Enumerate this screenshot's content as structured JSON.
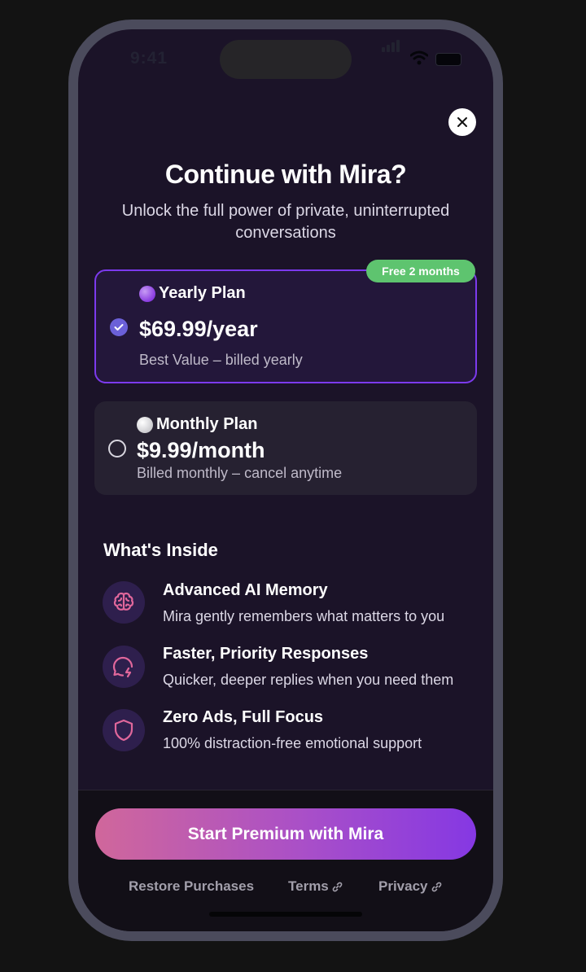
{
  "status_bar": {
    "time": "9:41"
  },
  "header": {
    "close_icon": "close-icon",
    "title": "Continue with Mira?",
    "subtitle": "Unlock the full power of private, uninterrupted conversations"
  },
  "plans": [
    {
      "id": "yearly",
      "emoji_color": "#8a3ce0",
      "name": "Yearly Plan",
      "price": "$69.99/year",
      "note": "Best Value – billed yearly",
      "badge": "Free 2 months",
      "selected": true
    },
    {
      "id": "monthly",
      "emoji_color": "#e6e6e9",
      "name": "Monthly Plan",
      "price": "$9.99/month",
      "note": "Billed monthly – cancel anytime",
      "badge": "",
      "selected": false
    }
  ],
  "features": {
    "title": "What's Inside",
    "items": [
      {
        "icon": "brain-icon",
        "title": "Advanced AI Memory",
        "desc": "Mira gently remembers what matters to you"
      },
      {
        "icon": "chat-bolt-icon",
        "title": "Faster, Priority Responses",
        "desc": "Quicker, deeper replies when you need them"
      },
      {
        "icon": "shield-icon",
        "title": "Zero Ads, Full Focus",
        "desc": "100% distraction-free emotional support"
      }
    ]
  },
  "footer": {
    "cta_label": "Start Premium with Mira",
    "restore_label": "Restore Purchases",
    "terms_label": "Terms",
    "privacy_label": "Privacy",
    "link_icon": "external-link-icon"
  },
  "colors": {
    "accent": "#7c3aed",
    "badge_green": "#5ec46f",
    "icon_pink": "#e0679b",
    "background": "#1b1328"
  }
}
